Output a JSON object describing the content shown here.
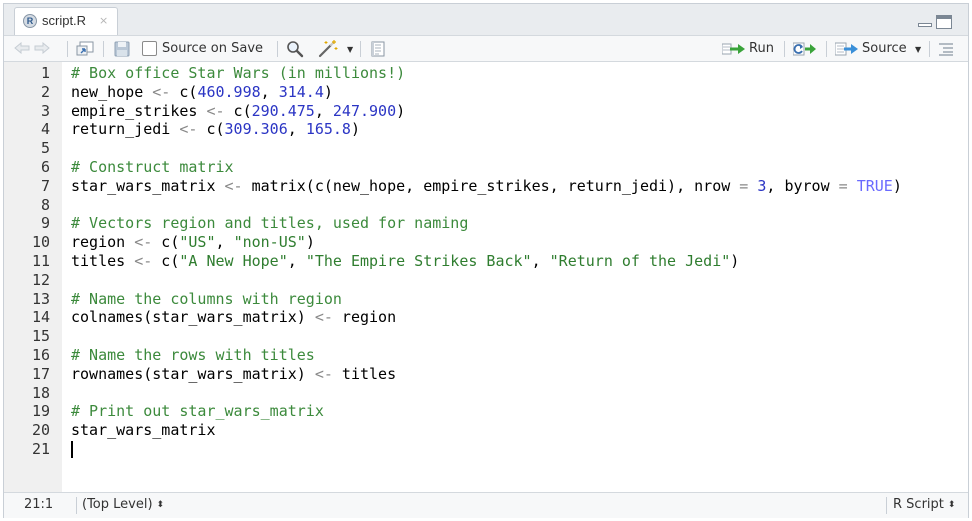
{
  "tab": {
    "icon": "r-file-icon",
    "icon_glyph": "R",
    "title": "script.R",
    "close_glyph": "×"
  },
  "toolbar": {
    "source_on_save": "Source on Save",
    "run": "Run",
    "source": "Source"
  },
  "colors": {
    "comment": "#3c8a3c",
    "number": "#2b35c4",
    "string": "#2f7d2f",
    "keyword": "#6a6aff",
    "operator": "#888888",
    "default": "#000000",
    "green_arrow": "#3aa33a"
  },
  "code_lines": [
    [
      {
        "t": "# Box office Star Wars (in millions!)",
        "c": "comment"
      }
    ],
    [
      {
        "t": "new_hope ",
        "c": "default"
      },
      {
        "t": "<-",
        "c": "operator"
      },
      {
        "t": " c(",
        "c": "default"
      },
      {
        "t": "460.998",
        "c": "number"
      },
      {
        "t": ", ",
        "c": "default"
      },
      {
        "t": "314.4",
        "c": "number"
      },
      {
        "t": ")",
        "c": "default"
      }
    ],
    [
      {
        "t": "empire_strikes ",
        "c": "default"
      },
      {
        "t": "<-",
        "c": "operator"
      },
      {
        "t": " c(",
        "c": "default"
      },
      {
        "t": "290.475",
        "c": "number"
      },
      {
        "t": ", ",
        "c": "default"
      },
      {
        "t": "247.900",
        "c": "number"
      },
      {
        "t": ")",
        "c": "default"
      }
    ],
    [
      {
        "t": "return_jedi ",
        "c": "default"
      },
      {
        "t": "<-",
        "c": "operator"
      },
      {
        "t": " c(",
        "c": "default"
      },
      {
        "t": "309.306",
        "c": "number"
      },
      {
        "t": ", ",
        "c": "default"
      },
      {
        "t": "165.8",
        "c": "number"
      },
      {
        "t": ")",
        "c": "default"
      }
    ],
    [],
    [
      {
        "t": "# Construct matrix",
        "c": "comment"
      }
    ],
    [
      {
        "t": "star_wars_matrix ",
        "c": "default"
      },
      {
        "t": "<-",
        "c": "operator"
      },
      {
        "t": " matrix(c(new_hope, empire_strikes, return_jedi), nrow ",
        "c": "default"
      },
      {
        "t": "=",
        "c": "operator"
      },
      {
        "t": " ",
        "c": "default"
      },
      {
        "t": "3",
        "c": "number"
      },
      {
        "t": ", byrow ",
        "c": "default"
      },
      {
        "t": "=",
        "c": "operator"
      },
      {
        "t": " ",
        "c": "default"
      },
      {
        "t": "TRUE",
        "c": "keyword"
      },
      {
        "t": ")",
        "c": "default"
      }
    ],
    [],
    [
      {
        "t": "# Vectors region and titles, used for naming",
        "c": "comment"
      }
    ],
    [
      {
        "t": "region ",
        "c": "default"
      },
      {
        "t": "<-",
        "c": "operator"
      },
      {
        "t": " c(",
        "c": "default"
      },
      {
        "t": "\"US\"",
        "c": "string"
      },
      {
        "t": ", ",
        "c": "default"
      },
      {
        "t": "\"non-US\"",
        "c": "string"
      },
      {
        "t": ")",
        "c": "default"
      }
    ],
    [
      {
        "t": "titles ",
        "c": "default"
      },
      {
        "t": "<-",
        "c": "operator"
      },
      {
        "t": " c(",
        "c": "default"
      },
      {
        "t": "\"A New Hope\"",
        "c": "string"
      },
      {
        "t": ", ",
        "c": "default"
      },
      {
        "t": "\"The Empire Strikes Back\"",
        "c": "string"
      },
      {
        "t": ", ",
        "c": "default"
      },
      {
        "t": "\"Return of the Jedi\"",
        "c": "string"
      },
      {
        "t": ")",
        "c": "default"
      }
    ],
    [],
    [
      {
        "t": "# Name the columns with region",
        "c": "comment"
      }
    ],
    [
      {
        "t": "colnames(star_wars_matrix) ",
        "c": "default"
      },
      {
        "t": "<-",
        "c": "operator"
      },
      {
        "t": " region",
        "c": "default"
      }
    ],
    [],
    [
      {
        "t": "# Name the rows with titles",
        "c": "comment"
      }
    ],
    [
      {
        "t": "rownames(star_wars_matrix) ",
        "c": "default"
      },
      {
        "t": "<-",
        "c": "operator"
      },
      {
        "t": " titles",
        "c": "default"
      }
    ],
    [],
    [
      {
        "t": "# Print out star_wars_matrix",
        "c": "comment"
      }
    ],
    [
      {
        "t": "star_wars_matrix",
        "c": "default"
      }
    ],
    []
  ],
  "status": {
    "position": "21:1",
    "scope": "(Top Level)",
    "language": "R Script",
    "updown_glyph": "⬍"
  }
}
